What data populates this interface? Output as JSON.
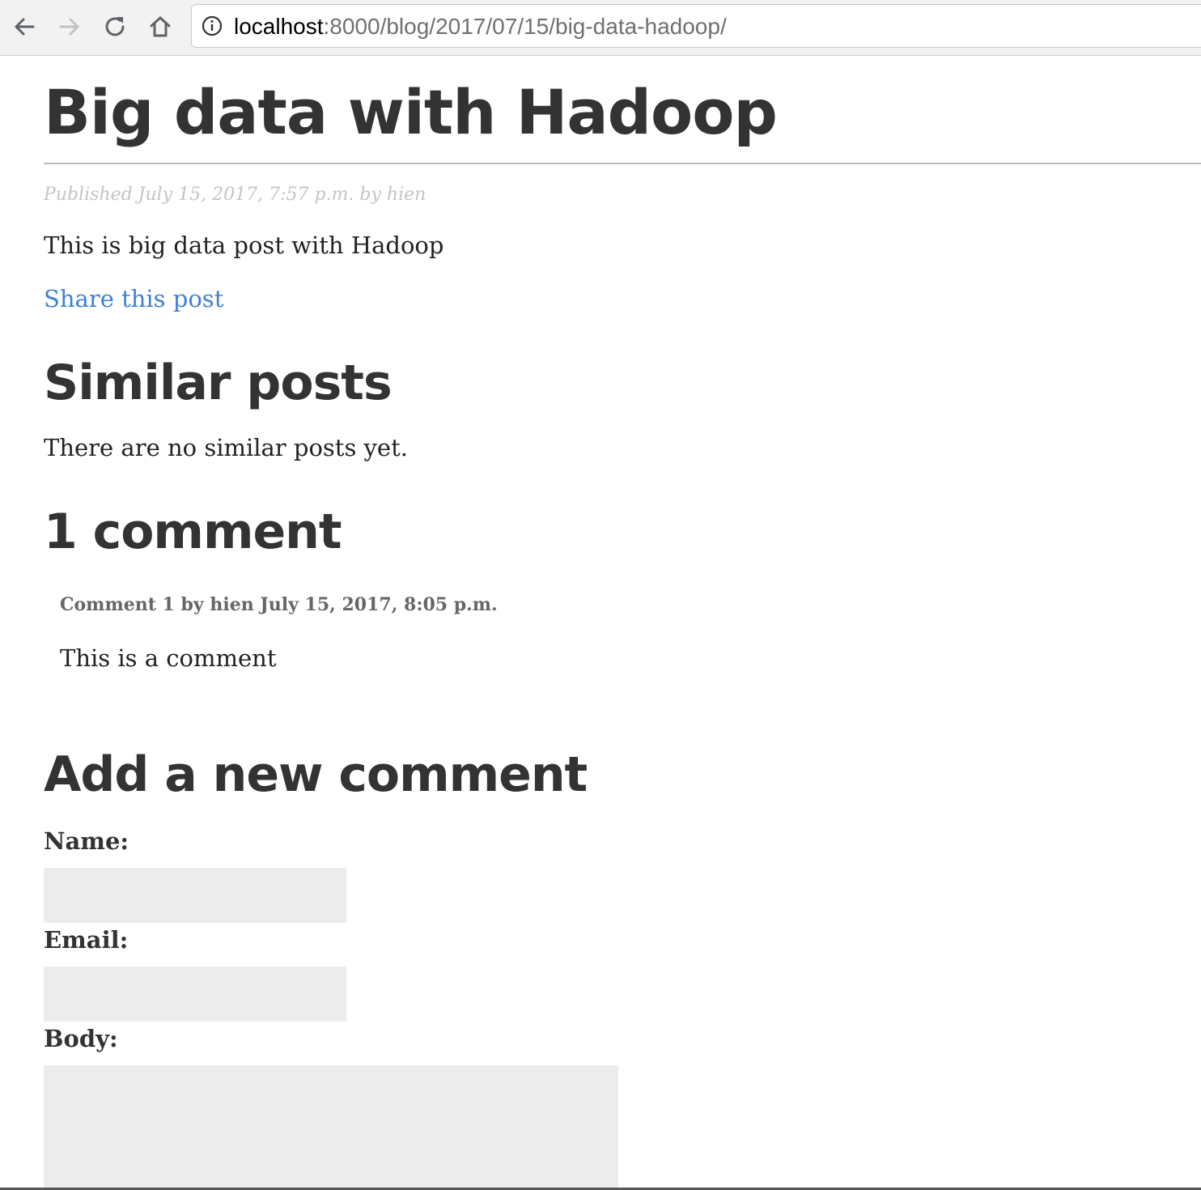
{
  "browser": {
    "url_host": "localhost",
    "url_path": ":8000/blog/2017/07/15/big-data-hadoop/",
    "icons": {
      "back": "arrow-left-icon",
      "forward": "arrow-right-icon",
      "reload": "reload-icon",
      "home": "home-icon",
      "info": "info-icon"
    }
  },
  "post": {
    "title": "Big data with Hadoop",
    "meta": "Published July 15, 2017, 7:57 p.m. by hien",
    "body": "This is big data post with Hadoop",
    "share_label": "Share this post"
  },
  "similar": {
    "title": "Similar posts",
    "empty_text": "There are no similar posts yet."
  },
  "comments": {
    "title": "1 comment",
    "items": [
      {
        "info": "Comment 1 by hien July 15, 2017, 8:05 p.m.",
        "body": "This is a comment"
      }
    ]
  },
  "form": {
    "title": "Add a new comment",
    "name_label": "Name:",
    "name_value": "",
    "email_label": "Email:",
    "email_value": "",
    "body_label": "Body:",
    "body_value": ""
  },
  "colors": {
    "link": "#3f7fd8",
    "text": "#333333",
    "meta": "#c4c4c4",
    "field_bg": "#ececec"
  }
}
